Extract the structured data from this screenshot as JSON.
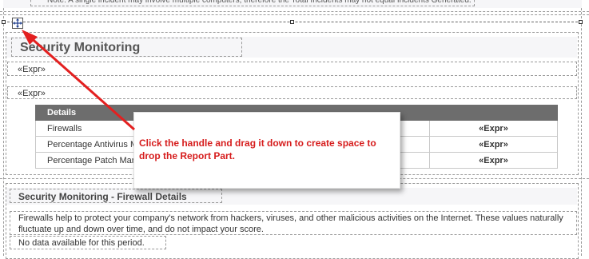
{
  "top_note": "Note: A single incident may involve multiple computers, therefore the Total Incidents may not equal Incidents Generated.",
  "section1": {
    "title": "Security Monitoring",
    "expr1": "«Expr»",
    "expr2": "«Expr»",
    "table": {
      "header": "Details",
      "rows": [
        {
          "label": "Firewalls",
          "value": "«Expr»"
        },
        {
          "label": "Percentage Antivirus Managed",
          "value": "«Expr»"
        },
        {
          "label": "Percentage Patch Managed",
          "value": "«Expr»"
        }
      ]
    }
  },
  "callout": {
    "text": "Click the handle and drag it down to create space to drop the Report Part."
  },
  "section2": {
    "title": "Security Monitoring - Firewall Details",
    "description": "Firewalls help to protect your company's network from hackers, viruses, and other malicious activities on the Internet.  These values naturally fluctuate up and down over time, and do not impact your score.",
    "no_data": "No data available for this period."
  },
  "colors": {
    "arrow": "#e32020",
    "header_bg": "#6d6d6d",
    "callout_text": "#d61c1c"
  },
  "icons": {
    "handle": "move-handle-icon"
  }
}
